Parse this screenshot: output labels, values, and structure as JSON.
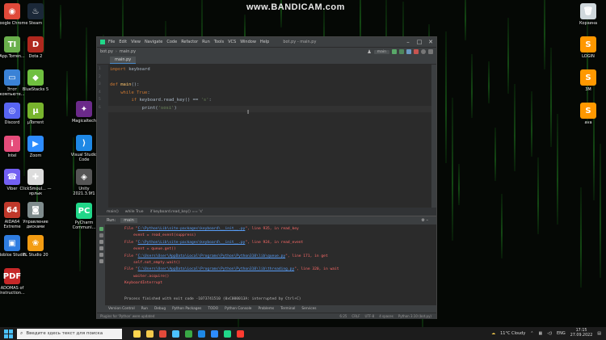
{
  "watermark": "www.BANDICAM.com",
  "desktop_left": [
    {
      "label": "Google Chrome",
      "icon": "chrome-icon",
      "glyph": "◉",
      "color": "#e04a3a"
    },
    {
      "label": "Steam",
      "icon": "steam-icon",
      "glyph": "♨",
      "color": "#1b2838"
    },
    {
      "label": "App.Torren...",
      "icon": "torrent-icon",
      "glyph": "TI",
      "color": "#6ab04c"
    },
    {
      "label": "Dota 2",
      "icon": "dota-icon",
      "glyph": "D",
      "color": "#b0281e"
    },
    {
      "label": "Этот компьюте...",
      "icon": "computer-icon",
      "glyph": "▭",
      "color": "#3a82d6"
    },
    {
      "label": "BlueStacks 5",
      "icon": "bluestacks-icon",
      "glyph": "◆",
      "color": "#6fbf3f"
    },
    {
      "label": "Discord",
      "icon": "discord-icon",
      "glyph": "◎",
      "color": "#5865f2"
    },
    {
      "label": "μTorrent",
      "icon": "utorrent-icon",
      "glyph": "μ",
      "color": "#78b42d"
    },
    {
      "label": "Intel",
      "icon": "intel-icon",
      "glyph": "i",
      "color": "#e54c7a"
    },
    {
      "label": "Zoom",
      "icon": "zoom-icon",
      "glyph": "▶",
      "color": "#2d8cff"
    },
    {
      "label": "Viber",
      "icon": "viber-icon",
      "glyph": "☎",
      "color": "#7360f2"
    },
    {
      "label": "ClickSmoul... — ярлык",
      "icon": "clicksmoul-icon",
      "glyph": "✚",
      "color": "#dddddd"
    },
    {
      "label": "AIDA64 Extreme",
      "icon": "aida64-icon",
      "glyph": "64",
      "color": "#c0392b"
    },
    {
      "label": "Управление дисками",
      "icon": "disk-management-icon",
      "glyph": "◙",
      "color": "#7f8c8d"
    },
    {
      "label": "Roblox Studio",
      "icon": "roblox-icon",
      "glyph": "▣",
      "color": "#2f7de1"
    },
    {
      "label": "FL Studio 20",
      "icon": "flstudio-icon",
      "glyph": "❀",
      "color": "#f39c12"
    },
    {
      "label": "ADOMAS of Instruction...",
      "icon": "pdf-icon",
      "glyph": "PDF",
      "color": "#c62828"
    }
  ],
  "desktop_mid": [
    {
      "label": "Magicaltech",
      "icon": "magicaltech-icon",
      "glyph": "✦",
      "color": "#6b2a8a"
    },
    {
      "label": "Visual Studio Code",
      "icon": "vscode-icon",
      "glyph": "⟩",
      "color": "#1e88e5"
    },
    {
      "label": "Unity 2021.3.9f1",
      "icon": "unity-icon",
      "glyph": "◈",
      "color": "#555555"
    },
    {
      "label": "PyCharm Communi...",
      "icon": "pycharm-icon",
      "glyph": "PC",
      "color": "#21d789"
    }
  ],
  "desktop_right": [
    {
      "label": "Корзина",
      "icon": "recycle-bin-icon",
      "glyph": "🗑",
      "color": "#cfd8dc"
    },
    {
      "label": "LOGIN",
      "icon": "sublime-icon",
      "glyph": "S",
      "color": "#ff9800"
    },
    {
      "label": "3M",
      "icon": "sublime-icon",
      "glyph": "S",
      "color": "#ff9800"
    },
    {
      "label": "ava",
      "icon": "sublime-icon",
      "glyph": "S",
      "color": "#ff9800"
    }
  ],
  "ide": {
    "menu": [
      "File",
      "Edit",
      "View",
      "Navigate",
      "Code",
      "Refactor",
      "Run",
      "Tools",
      "VCS",
      "Window",
      "Help"
    ],
    "title": "bot.py - main.py",
    "breadcrumb_project": "bot.py",
    "breadcrumb_file": "main.py",
    "run_config": "main",
    "tab": "main.py",
    "code_lines": [
      {
        "n": "1",
        "parts": [
          {
            "t": "import ",
            "c": "kw"
          },
          {
            "t": "keyboard",
            "c": ""
          }
        ]
      },
      {
        "n": "2",
        "parts": []
      },
      {
        "n": "3",
        "parts": [
          {
            "t": "def ",
            "c": "kw"
          },
          {
            "t": "main",
            "c": "fn"
          },
          {
            "t": "():",
            "c": ""
          }
        ]
      },
      {
        "n": "4",
        "parts": [
          {
            "t": "    ",
            "c": ""
          },
          {
            "t": "while ",
            "c": "kw"
          },
          {
            "t": "True",
            "c": "kw"
          },
          {
            "t": ":",
            "c": ""
          }
        ]
      },
      {
        "n": "5",
        "parts": [
          {
            "t": "        ",
            "c": ""
          },
          {
            "t": "if ",
            "c": "kw"
          },
          {
            "t": "keyboard.read_key() == ",
            "c": ""
          },
          {
            "t": "'s'",
            "c": "str"
          },
          {
            "t": ":",
            "c": ""
          }
        ]
      },
      {
        "n": "6",
        "parts": [
          {
            "t": "            print(",
            "c": ""
          },
          {
            "t": "'sosi'",
            "c": "str"
          },
          {
            "t": ")",
            "c": ""
          }
        ]
      }
    ],
    "code_breadcrumb": [
      "main()",
      "while True",
      "if keyboard.read_key() == 's'"
    ],
    "run_label": "Run:",
    "run_tab": "main",
    "output_lines": [
      {
        "pre": "File \"",
        "link": "C:\\Python\\Lib\\site-packages\\keyboard\\__init__.py",
        "post": "\", line 935, in read_key"
      },
      {
        "pre": "    event = read_event(suppress)",
        "link": "",
        "post": ""
      },
      {
        "pre": "File \"",
        "link": "C:\\Python\\Lib\\site-packages\\keyboard\\__init__.py",
        "post": "\", line 924, in read_event"
      },
      {
        "pre": "    event = queue.get()",
        "link": "",
        "post": ""
      },
      {
        "pre": "File \"",
        "link": "C:\\Users\\User\\AppData\\Local\\Programs\\Python\\Python310\\lib\\queue.py",
        "post": "\", line 171, in get"
      },
      {
        "pre": "    self.not_empty.wait()",
        "link": "",
        "post": ""
      },
      {
        "pre": "File \"",
        "link": "C:\\Users\\User\\AppData\\Local\\Programs\\Python\\Python310\\lib\\threading.py",
        "post": "\", line 320, in wait"
      },
      {
        "pre": "    waiter.acquire()",
        "link": "",
        "post": ""
      },
      {
        "pre": "KeyboardInterrupt",
        "link": "",
        "post": ""
      }
    ],
    "exit_message": "Process finished with exit code -1073741510 (0xC000013A: interrupted by Ctrl+C)",
    "bottom_tools": [
      "Version Control",
      "Run",
      "Debug",
      "Python Packages",
      "TODO",
      "Python Console",
      "Problems",
      "Terminal",
      "Services"
    ],
    "status_left": "Plugins for 'Python' were updated",
    "status_right": [
      "6:25",
      "CRLF",
      "UTF-8",
      "4 spaces",
      "Python 3.10 (bot.py)"
    ]
  },
  "taskbar": {
    "search_placeholder": "Введите здесь текст для поиска",
    "weather": "11°C  Cloudy",
    "lang": "ENG",
    "time": "17:15",
    "date": "27.09.2022",
    "icon_colors": [
      "#ffd54f",
      "#f2c94c",
      "#e24a3a",
      "#4cc2ff",
      "#39a845",
      "#1e88e5",
      "#2d8cff",
      "#21d789",
      "#ff3b30"
    ]
  }
}
